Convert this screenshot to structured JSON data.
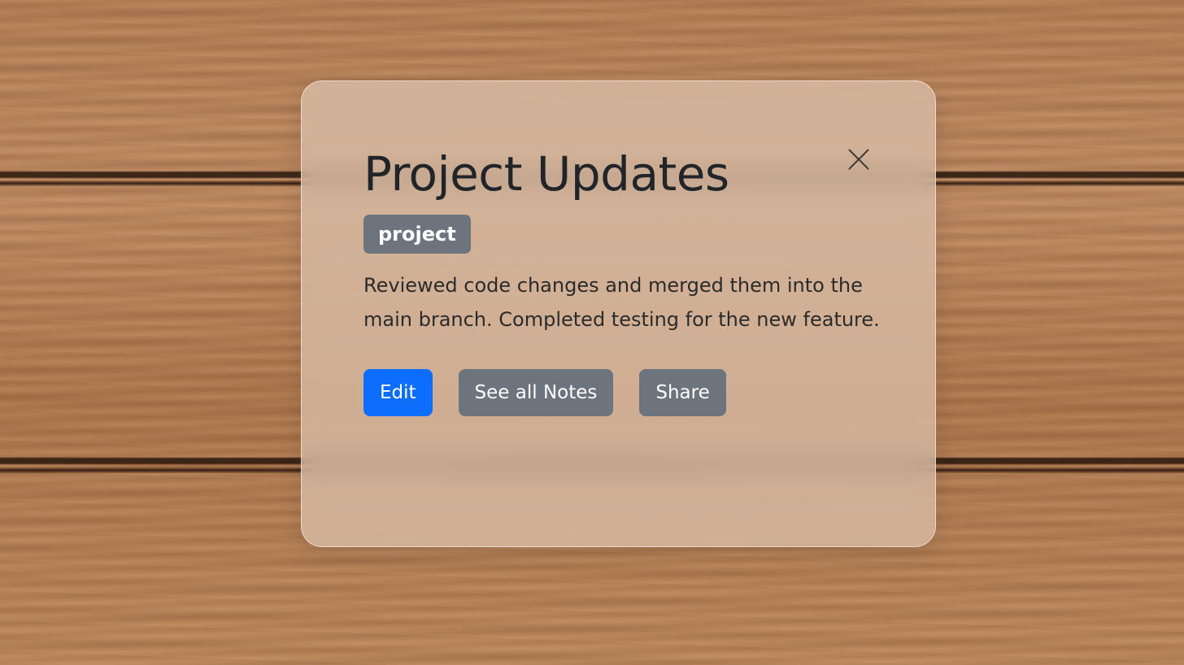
{
  "background": {
    "type": "wood-texture",
    "accent": "#b98257"
  },
  "modal": {
    "title": "Project Updates",
    "tag": "project",
    "description": "Reviewed code changes and merged them into the main branch. Completed testing for the new feature.",
    "close_icon": "close-icon",
    "actions": [
      {
        "label": "Edit",
        "style": "primary",
        "color": "#0d6efd"
      },
      {
        "label": "See all Notes",
        "style": "secondary",
        "color": "#6c757d"
      },
      {
        "label": "Share",
        "style": "secondary",
        "color": "#6c757d"
      }
    ]
  }
}
